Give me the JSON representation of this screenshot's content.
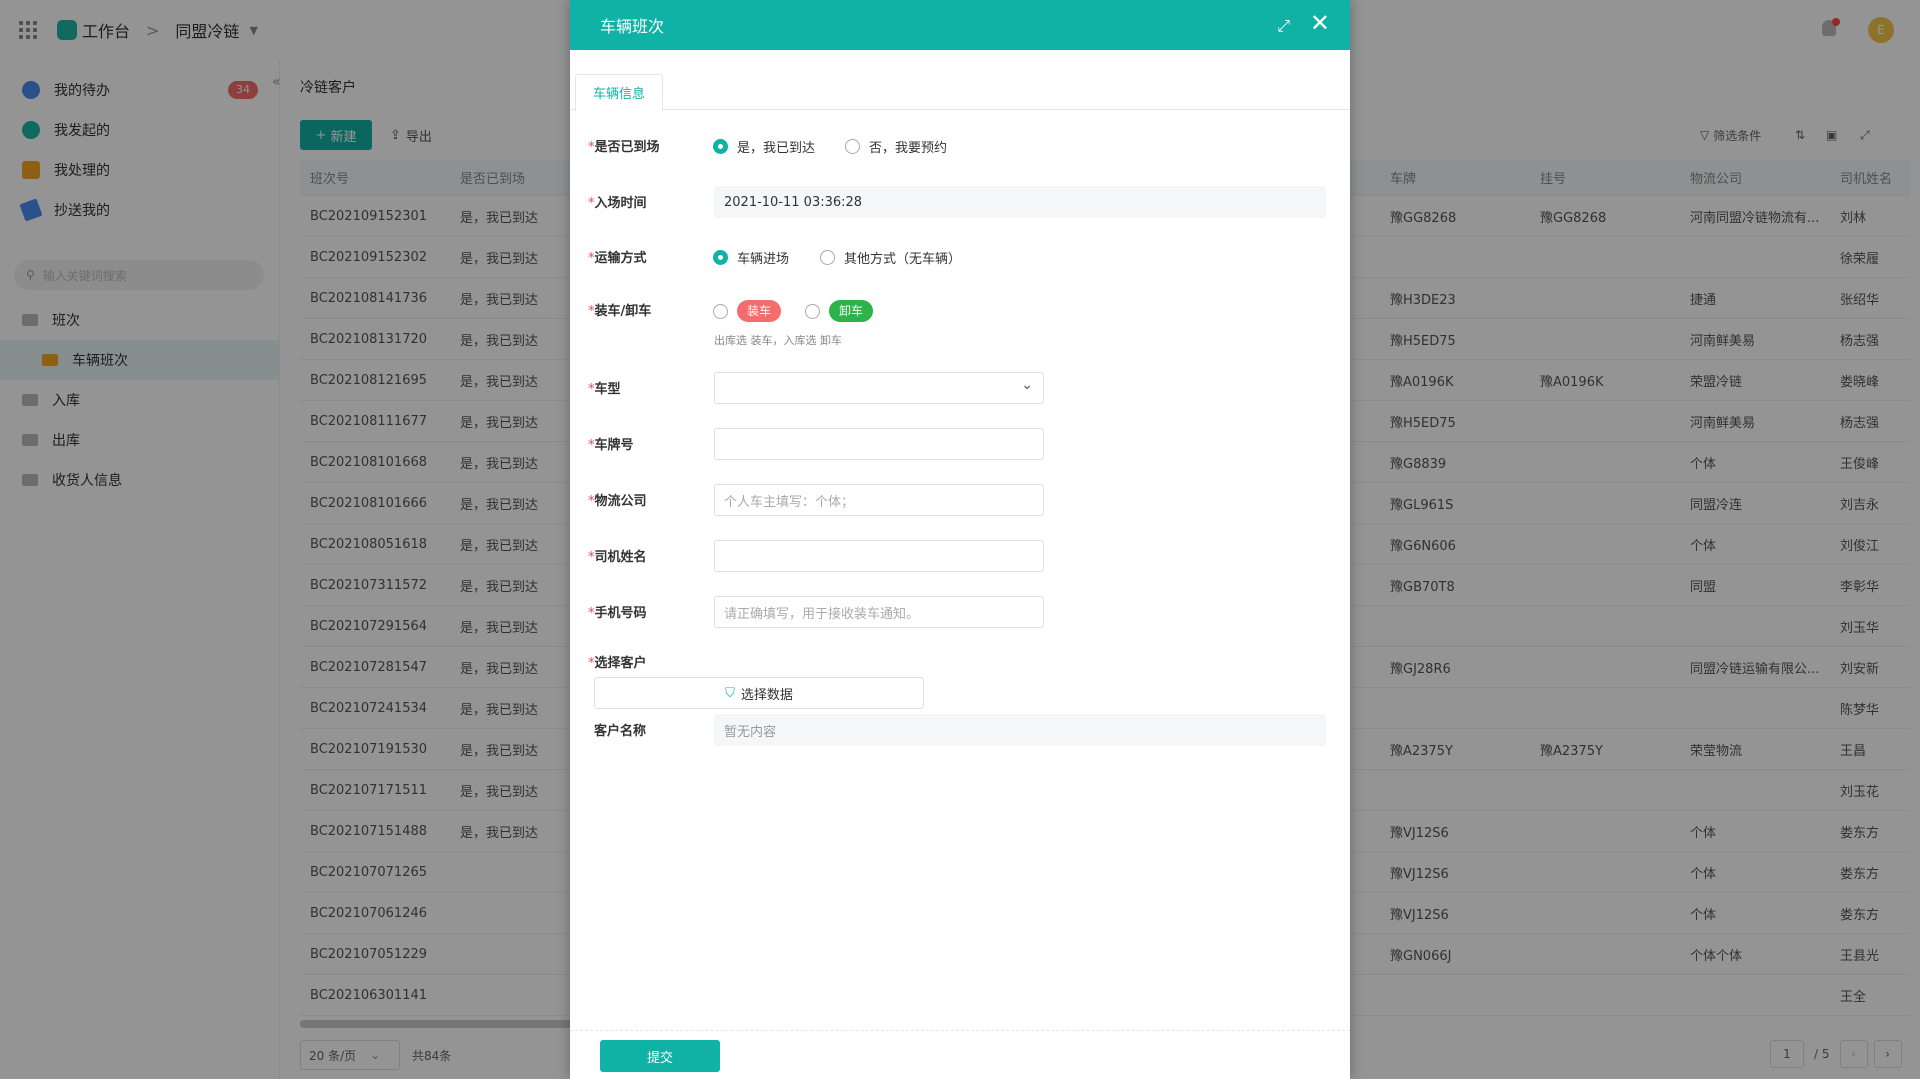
{
  "topbar": {
    "workspace": "工作台",
    "separator": ">",
    "app": "同盟冷链",
    "avatar_initial": "E"
  },
  "sidebar": {
    "items": [
      {
        "label": "我的待办",
        "badge": "34"
      },
      {
        "label": "我发起的"
      },
      {
        "label": "我处理的"
      },
      {
        "label": "抄送我的"
      }
    ],
    "search_placeholder": "输入关键词搜索",
    "tree": [
      {
        "label": "班次"
      },
      {
        "label": "车辆班次"
      },
      {
        "label": "入库"
      },
      {
        "label": "出库"
      },
      {
        "label": "收货人信息"
      }
    ]
  },
  "content": {
    "title": "冷链客户",
    "new_button": "新建",
    "export_button": "导出",
    "filter_label": "筛选条件",
    "columns": [
      "班次号",
      "是否已到场",
      "车牌",
      "挂号",
      "物流公司",
      "司机姓名"
    ],
    "rows": [
      [
        "BC202109152301",
        "是，我已到达",
        "豫GG8268",
        "豫GG8268",
        "河南同盟冷链物流有...",
        "刘林"
      ],
      [
        "BC202109152302",
        "是，我已到达",
        "",
        "",
        "",
        "徐荣履"
      ],
      [
        "BC202108141736",
        "是，我已到达",
        "豫H3DE23",
        "",
        "捷通",
        "张绍华"
      ],
      [
        "BC202108131720",
        "是，我已到达",
        "豫H5ED75",
        "",
        "河南鲜美易",
        "杨志强"
      ],
      [
        "BC202108121695",
        "是，我已到达",
        "豫A0196K",
        "豫A0196K",
        "荣盟冷链",
        "娄晓峰"
      ],
      [
        "BC202108111677",
        "是，我已到达",
        "豫H5ED75",
        "",
        "河南鲜美易",
        "杨志强"
      ],
      [
        "BC202108101668",
        "是，我已到达",
        "豫G8839",
        "",
        "个体",
        "王俊峰"
      ],
      [
        "BC202108101666",
        "是，我已到达",
        "豫GL961S",
        "",
        "同盟冷连",
        "刘吉永"
      ],
      [
        "BC202108051618",
        "是，我已到达",
        "豫G6N606",
        "",
        "个体",
        "刘俊江"
      ],
      [
        "BC202107311572",
        "是，我已到达",
        "豫GB70T8",
        "",
        "同盟",
        "李彰华"
      ],
      [
        "BC202107291564",
        "是，我已到达",
        "",
        "",
        "",
        "刘玉华"
      ],
      [
        "BC202107281547",
        "是，我已到达",
        "豫GJ28R6",
        "",
        "同盟冷链运输有限公...",
        "刘安新"
      ],
      [
        "BC202107241534",
        "是，我已到达",
        "",
        "",
        "",
        "陈梦华"
      ],
      [
        "BC202107191530",
        "是，我已到达",
        "豫A2375Y",
        "豫A2375Y",
        "荣莹物流",
        "王昌"
      ],
      [
        "BC202107171511",
        "是，我已到达",
        "",
        "",
        "",
        "刘玉花"
      ],
      [
        "BC202107151488",
        "是，我已到达",
        "豫VJ12S6",
        "",
        "个体",
        "娄东方"
      ],
      [
        "BC202107071265",
        "",
        "豫VJ12S6",
        "",
        "个体",
        "娄东方"
      ],
      [
        "BC202107061246",
        "",
        "豫VJ12S6",
        "",
        "个体",
        "娄东方"
      ],
      [
        "BC202107051229",
        "",
        "豫GN066J",
        "",
        "个体个体",
        "王县光"
      ],
      [
        "BC202106301141",
        "",
        "",
        "",
        "",
        "王全"
      ]
    ],
    "page_size": "20 条/页",
    "total": "共84条",
    "page_current": "1",
    "page_total": "/ 5"
  },
  "modal": {
    "title": "车辆班次",
    "tab": "车辆信息",
    "fields": {
      "arrived": {
        "label": "是否已到场",
        "opt_yes": "是，我已到达",
        "opt_no": "否，我要预约"
      },
      "entry_time": {
        "label": "入场时间",
        "value": "2021-10-11 03:36:28"
      },
      "transport": {
        "label": "运输方式",
        "opt_vehicle": "车辆进场",
        "opt_other": "其他方式（无车辆）"
      },
      "load": {
        "label": "装车/卸车",
        "opt_load": "装车",
        "opt_unload": "卸车",
        "hint": "出库选 装车，入库选 卸车"
      },
      "vehicle_type": {
        "label": "车型",
        "value": ""
      },
      "plate": {
        "label": "车牌号",
        "value": ""
      },
      "logistics": {
        "label": "物流公司",
        "placeholder": "个人车主填写：个体；"
      },
      "driver": {
        "label": "司机姓名",
        "value": ""
      },
      "phone": {
        "label": "手机号码",
        "placeholder": "请正确填写，用于接收装车通知。"
      },
      "customer": {
        "label": "选择客户",
        "button": "选择数据"
      },
      "customer_name": {
        "label": "客户名称",
        "value": "暂无内容"
      }
    },
    "submit": "提交"
  },
  "colors": {
    "accent": "#10b2a6",
    "load_tag": "#f56c6c",
    "unload_tag": "#2db34a"
  }
}
